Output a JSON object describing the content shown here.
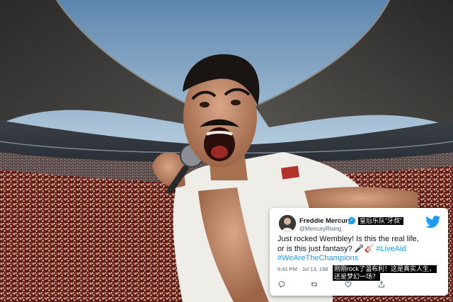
{
  "tweet": {
    "display_name": "Freddie Mercury",
    "handle": "@MercuryRising",
    "text_line1": "Just rocked Wembley! Is this the real life,",
    "text_line2_prefix": "or is this just fantasy? ",
    "emoji": "🎤🎸",
    "hashtag1": "#LiveAid",
    "hashtag2": "#WeAreTheChampions",
    "time": "6:41 PM",
    "date": "Jul 13, 198"
  },
  "captions": {
    "name_note": "皇后乐队“牙叔”",
    "line1": "刚刚rock了温布利！这是真实人生，",
    "line2": "还是梦幻一场？"
  },
  "colors": {
    "accent": "#1d9bf0",
    "caption_bg": "#000000"
  },
  "icons": [
    "verified-icon",
    "twitter-bird-icon",
    "reply-icon",
    "retweet-icon",
    "like-icon",
    "share-icon"
  ]
}
